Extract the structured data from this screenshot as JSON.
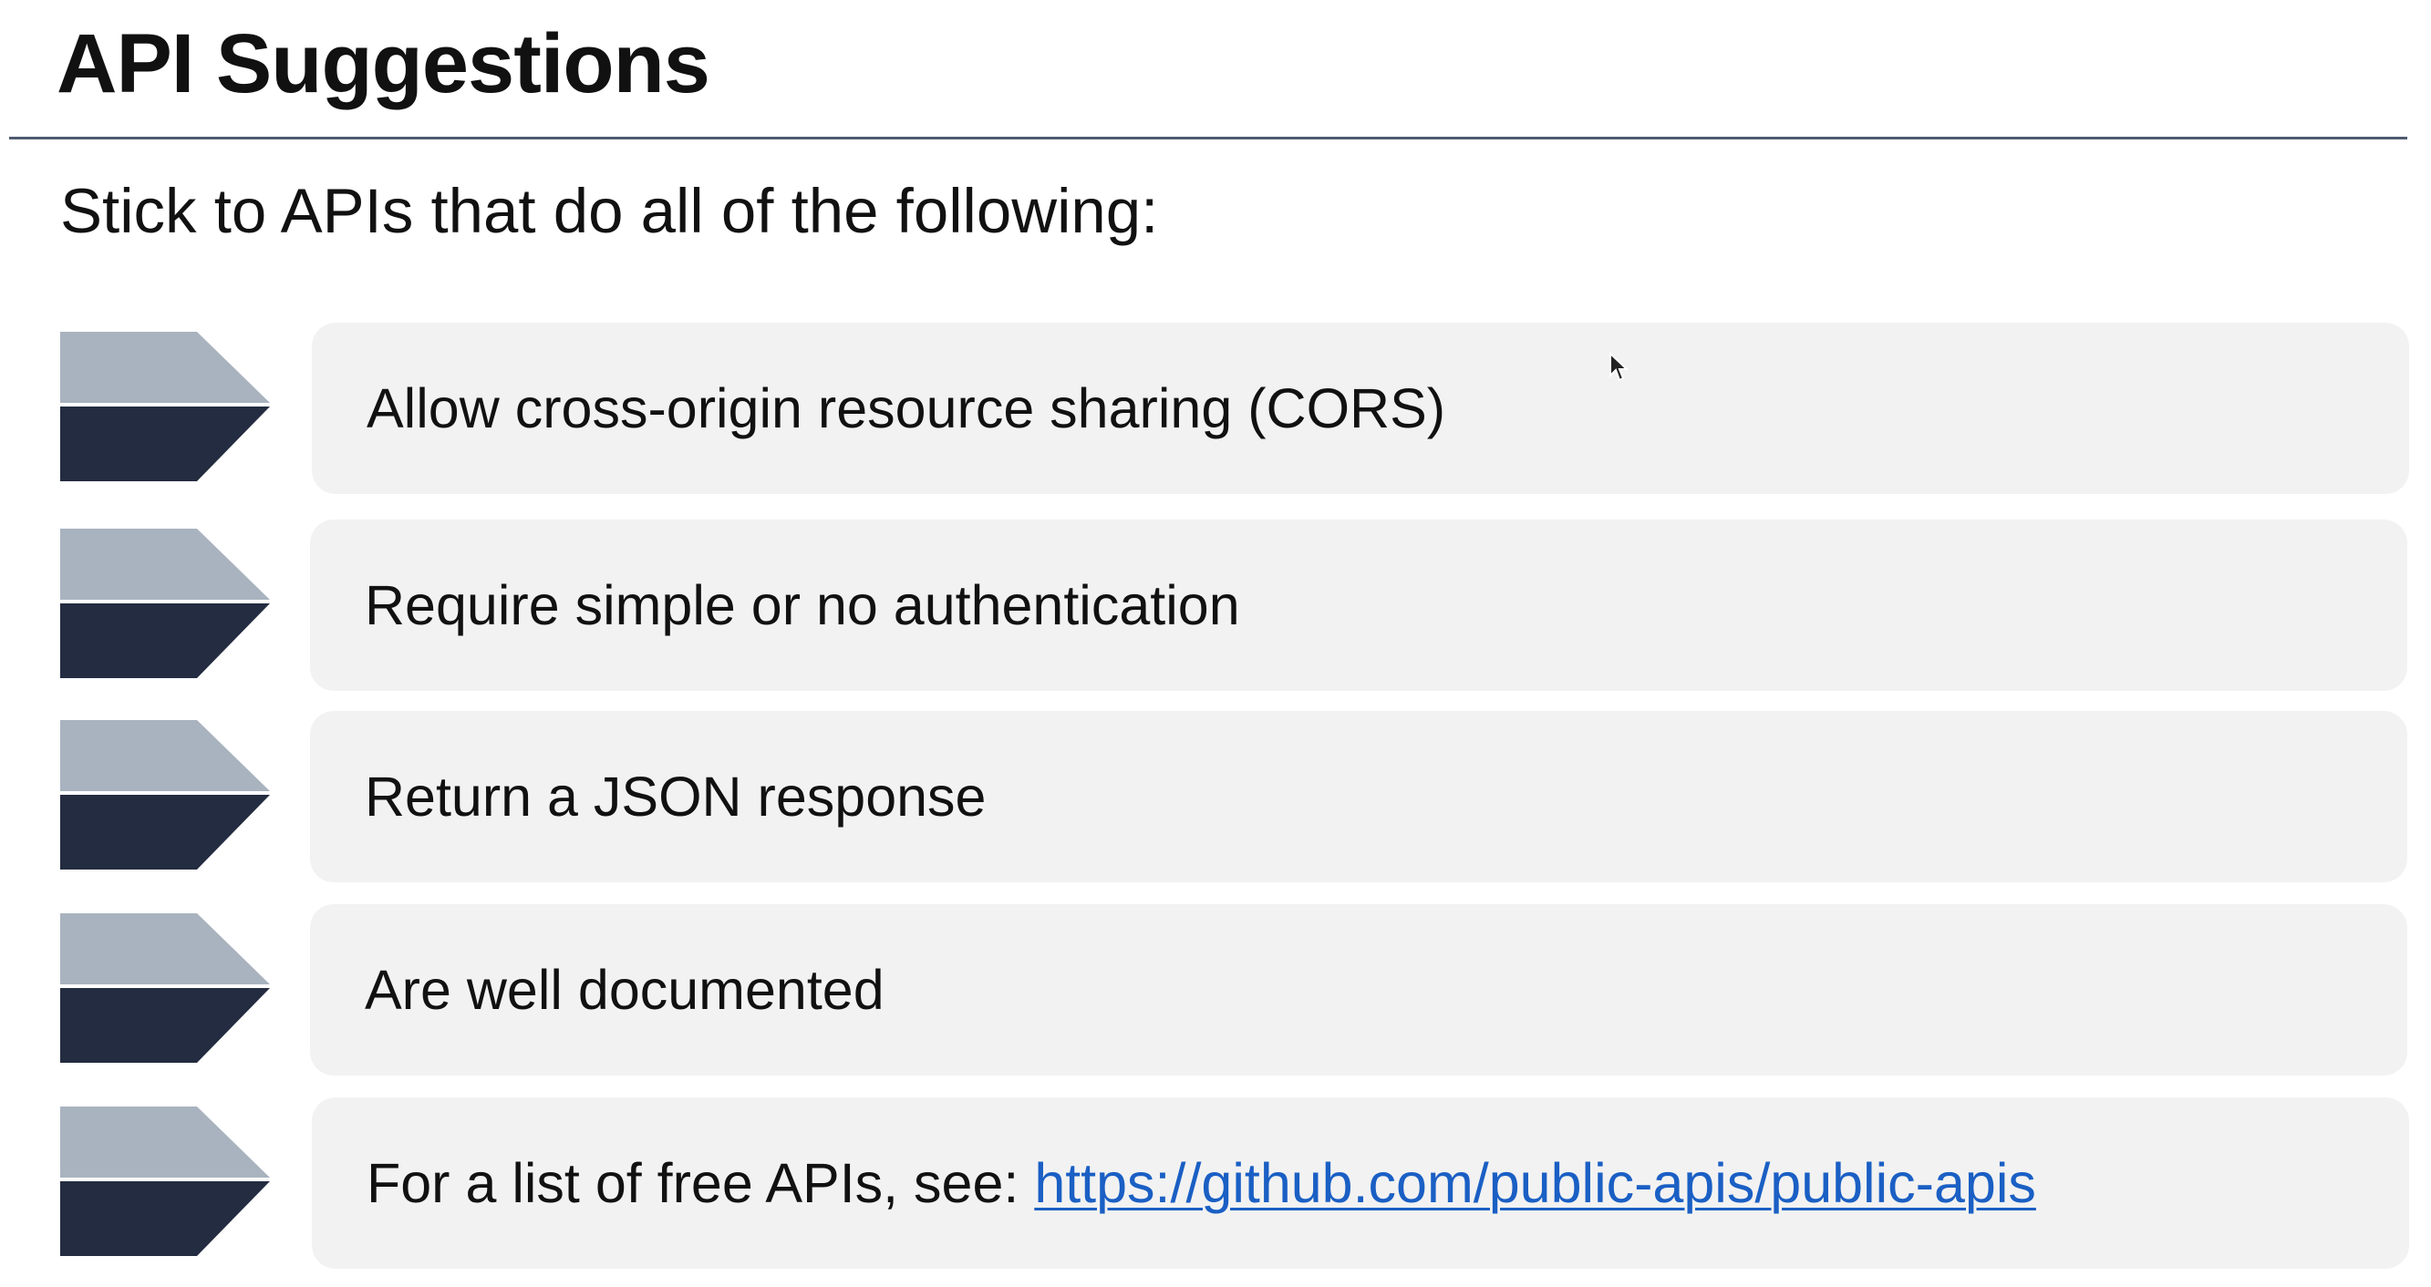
{
  "slide": {
    "title": "API Suggestions",
    "subtitle": "Stick to APIs that do all of the following:"
  },
  "items": [
    {
      "text": "Allow cross-origin resource sharing (CORS)"
    },
    {
      "text": "Require simple or no authentication"
    },
    {
      "text": "Return a JSON response"
    },
    {
      "text": "Are well documented"
    },
    {
      "text": "For a list of free APIs, see: ",
      "link": "https://github.com/public-apis/public-apis"
    }
  ],
  "colors": {
    "chevron_light": "#a9b3bf",
    "chevron_dark": "#232c40",
    "card_bg": "#f2f2f2",
    "link": "#1a5fc4",
    "title_rule": "#4f5b70"
  },
  "icons": {
    "bullet": "chevron-arrow-icon",
    "pointer": "mouse-cursor-icon"
  }
}
